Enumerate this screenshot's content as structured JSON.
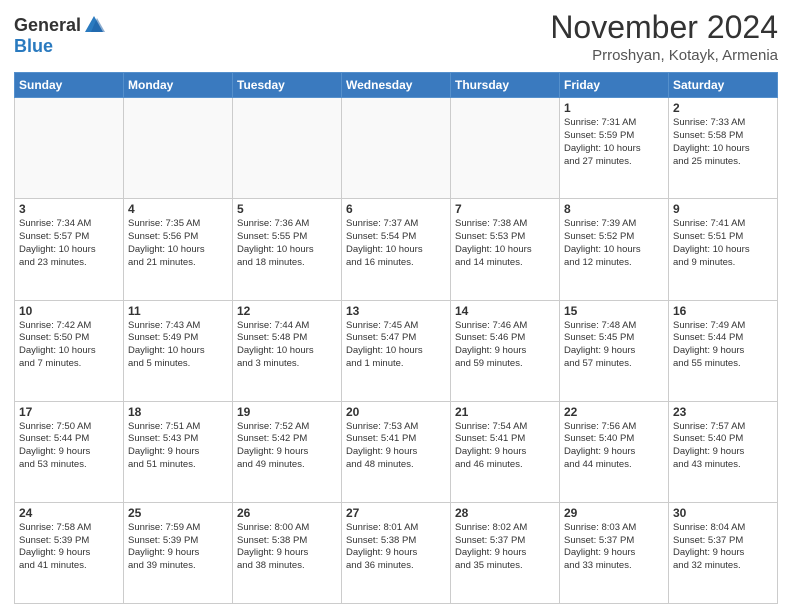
{
  "header": {
    "logo_general": "General",
    "logo_blue": "Blue",
    "month_title": "November 2024",
    "location": "Prroshyan, Kotayk, Armenia"
  },
  "days_of_week": [
    "Sunday",
    "Monday",
    "Tuesday",
    "Wednesday",
    "Thursday",
    "Friday",
    "Saturday"
  ],
  "weeks": [
    {
      "days": [
        {
          "date": "",
          "info": ""
        },
        {
          "date": "",
          "info": ""
        },
        {
          "date": "",
          "info": ""
        },
        {
          "date": "",
          "info": ""
        },
        {
          "date": "",
          "info": ""
        },
        {
          "date": "1",
          "info": "Sunrise: 7:31 AM\nSunset: 5:59 PM\nDaylight: 10 hours\nand 27 minutes."
        },
        {
          "date": "2",
          "info": "Sunrise: 7:33 AM\nSunset: 5:58 PM\nDaylight: 10 hours\nand 25 minutes."
        }
      ]
    },
    {
      "days": [
        {
          "date": "3",
          "info": "Sunrise: 7:34 AM\nSunset: 5:57 PM\nDaylight: 10 hours\nand 23 minutes."
        },
        {
          "date": "4",
          "info": "Sunrise: 7:35 AM\nSunset: 5:56 PM\nDaylight: 10 hours\nand 21 minutes."
        },
        {
          "date": "5",
          "info": "Sunrise: 7:36 AM\nSunset: 5:55 PM\nDaylight: 10 hours\nand 18 minutes."
        },
        {
          "date": "6",
          "info": "Sunrise: 7:37 AM\nSunset: 5:54 PM\nDaylight: 10 hours\nand 16 minutes."
        },
        {
          "date": "7",
          "info": "Sunrise: 7:38 AM\nSunset: 5:53 PM\nDaylight: 10 hours\nand 14 minutes."
        },
        {
          "date": "8",
          "info": "Sunrise: 7:39 AM\nSunset: 5:52 PM\nDaylight: 10 hours\nand 12 minutes."
        },
        {
          "date": "9",
          "info": "Sunrise: 7:41 AM\nSunset: 5:51 PM\nDaylight: 10 hours\nand 9 minutes."
        }
      ]
    },
    {
      "days": [
        {
          "date": "10",
          "info": "Sunrise: 7:42 AM\nSunset: 5:50 PM\nDaylight: 10 hours\nand 7 minutes."
        },
        {
          "date": "11",
          "info": "Sunrise: 7:43 AM\nSunset: 5:49 PM\nDaylight: 10 hours\nand 5 minutes."
        },
        {
          "date": "12",
          "info": "Sunrise: 7:44 AM\nSunset: 5:48 PM\nDaylight: 10 hours\nand 3 minutes."
        },
        {
          "date": "13",
          "info": "Sunrise: 7:45 AM\nSunset: 5:47 PM\nDaylight: 10 hours\nand 1 minute."
        },
        {
          "date": "14",
          "info": "Sunrise: 7:46 AM\nSunset: 5:46 PM\nDaylight: 9 hours\nand 59 minutes."
        },
        {
          "date": "15",
          "info": "Sunrise: 7:48 AM\nSunset: 5:45 PM\nDaylight: 9 hours\nand 57 minutes."
        },
        {
          "date": "16",
          "info": "Sunrise: 7:49 AM\nSunset: 5:44 PM\nDaylight: 9 hours\nand 55 minutes."
        }
      ]
    },
    {
      "days": [
        {
          "date": "17",
          "info": "Sunrise: 7:50 AM\nSunset: 5:44 PM\nDaylight: 9 hours\nand 53 minutes."
        },
        {
          "date": "18",
          "info": "Sunrise: 7:51 AM\nSunset: 5:43 PM\nDaylight: 9 hours\nand 51 minutes."
        },
        {
          "date": "19",
          "info": "Sunrise: 7:52 AM\nSunset: 5:42 PM\nDaylight: 9 hours\nand 49 minutes."
        },
        {
          "date": "20",
          "info": "Sunrise: 7:53 AM\nSunset: 5:41 PM\nDaylight: 9 hours\nand 48 minutes."
        },
        {
          "date": "21",
          "info": "Sunrise: 7:54 AM\nSunset: 5:41 PM\nDaylight: 9 hours\nand 46 minutes."
        },
        {
          "date": "22",
          "info": "Sunrise: 7:56 AM\nSunset: 5:40 PM\nDaylight: 9 hours\nand 44 minutes."
        },
        {
          "date": "23",
          "info": "Sunrise: 7:57 AM\nSunset: 5:40 PM\nDaylight: 9 hours\nand 43 minutes."
        }
      ]
    },
    {
      "days": [
        {
          "date": "24",
          "info": "Sunrise: 7:58 AM\nSunset: 5:39 PM\nDaylight: 9 hours\nand 41 minutes."
        },
        {
          "date": "25",
          "info": "Sunrise: 7:59 AM\nSunset: 5:39 PM\nDaylight: 9 hours\nand 39 minutes."
        },
        {
          "date": "26",
          "info": "Sunrise: 8:00 AM\nSunset: 5:38 PM\nDaylight: 9 hours\nand 38 minutes."
        },
        {
          "date": "27",
          "info": "Sunrise: 8:01 AM\nSunset: 5:38 PM\nDaylight: 9 hours\nand 36 minutes."
        },
        {
          "date": "28",
          "info": "Sunrise: 8:02 AM\nSunset: 5:37 PM\nDaylight: 9 hours\nand 35 minutes."
        },
        {
          "date": "29",
          "info": "Sunrise: 8:03 AM\nSunset: 5:37 PM\nDaylight: 9 hours\nand 33 minutes."
        },
        {
          "date": "30",
          "info": "Sunrise: 8:04 AM\nSunset: 5:37 PM\nDaylight: 9 hours\nand 32 minutes."
        }
      ]
    }
  ]
}
